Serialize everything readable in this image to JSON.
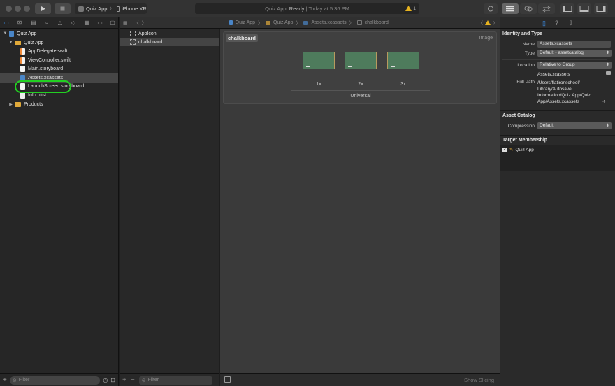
{
  "toolbar": {
    "scheme_target": "Quiz App",
    "scheme_device": "iPhone XR",
    "activity_app": "Quiz App:",
    "activity_status": "Ready",
    "activity_time": "| Today at 5:36 PM",
    "warning_count": "1"
  },
  "navigator": {
    "project": "Quiz App",
    "group": "Quiz App",
    "files": [
      "AppDelegate.swift",
      "ViewController.swift",
      "Main.storyboard",
      "Assets.xcassets",
      "LaunchScreen.storyboard",
      "Info.plist"
    ],
    "products": "Products",
    "filter_placeholder": "Filter"
  },
  "asset_list": {
    "items": [
      "AppIcon",
      "chalkboard"
    ],
    "filter_placeholder": "Filter"
  },
  "jumpbar": [
    "Quiz App",
    "Quiz App",
    "Assets.xcassets",
    "chalkboard"
  ],
  "editor": {
    "set_name": "chalkboard",
    "set_type": "Image",
    "slots": [
      "1x",
      "2x",
      "3x"
    ],
    "device": "Universal",
    "show_slicing": "Show Slicing"
  },
  "inspector": {
    "identity_header": "Identity and Type",
    "name_label": "Name",
    "name_value": "Assets.xcassets",
    "type_label": "Type",
    "type_value": "Default - assetcatalog",
    "location_label": "Location",
    "location_value": "Relative to Group",
    "location_file": "Assets.xcassets",
    "fullpath_label": "Full Path",
    "fullpath_lines": [
      "/Users/flatironschool/",
      "Library/Autosave",
      "Information/Quiz App/Quiz",
      "App/Assets.xcassets"
    ],
    "catalog_header": "Asset Catalog",
    "compression_label": "Compression",
    "compression_value": "Default",
    "membership_header": "Target Membership",
    "membership_target": "Quiz App"
  },
  "colors": {
    "highlight_circle": "#22d022",
    "folder": "#e0a93a",
    "chalkboard_frame": "#b89a5e",
    "chalkboard_green": "#4e7b5c"
  }
}
